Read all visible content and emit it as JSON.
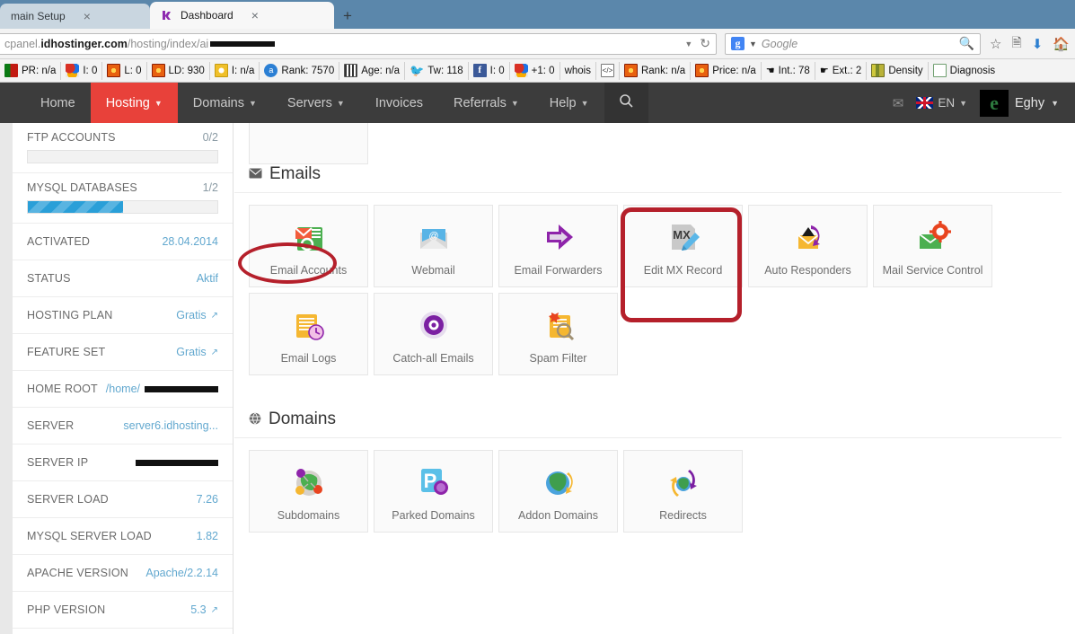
{
  "browser": {
    "tabs": [
      {
        "title": "main Setup",
        "active": false,
        "favicon": "none",
        "close_label": "×"
      },
      {
        "title": "Dashboard",
        "active": true,
        "favicon": "hostinger-icon",
        "close_label": "×"
      }
    ],
    "new_tab_label": "+",
    "url": {
      "prefix": "cpanel.",
      "host": "idhostinger.com",
      "path": "/hosting/index/ai",
      "redacted": true
    },
    "search": {
      "engine": "Google",
      "placeholder": "Google"
    },
    "toolbar_icons": [
      "dropdown-icon",
      "reload-icon",
      "bookmark-star-icon",
      "reader-icon",
      "download-icon",
      "home-icon"
    ],
    "bookmarks": [
      {
        "icon": "pagerank-icon",
        "label": "PR: n/a"
      },
      {
        "icon": "google-icon",
        "label": "I: 0"
      },
      {
        "icon": "sun-icon",
        "label": "L: 0"
      },
      {
        "icon": "sun-icon",
        "label": "LD: 930"
      },
      {
        "icon": "ring-icon",
        "label": "I: n/a"
      },
      {
        "icon": "alexa-icon",
        "label": "Rank: 7570"
      },
      {
        "icon": "barcode-icon",
        "label": "Age: n/a"
      },
      {
        "icon": "twitter-icon",
        "label": "Tw: 118"
      },
      {
        "icon": "facebook-icon",
        "label": "I: 0"
      },
      {
        "icon": "google-plus-icon",
        "label": "+1: 0"
      },
      {
        "icon": "none",
        "label": "whois"
      },
      {
        "icon": "code-icon",
        "label": ""
      },
      {
        "icon": "sun-icon",
        "label": "Rank: n/a"
      },
      {
        "icon": "sun-icon",
        "label": "Price: n/a"
      },
      {
        "icon": "hand-left-icon",
        "label": "Int.: 78"
      },
      {
        "icon": "hand-right-icon",
        "label": "Ext.: 2"
      },
      {
        "icon": "density-icon",
        "label": "Density"
      },
      {
        "icon": "diagnosis-icon",
        "label": "Diagnosis"
      }
    ]
  },
  "topnav": {
    "items": [
      {
        "label": "Home",
        "caret": false,
        "active": false
      },
      {
        "label": "Hosting",
        "caret": true,
        "active": true
      },
      {
        "label": "Domains",
        "caret": true,
        "active": false
      },
      {
        "label": "Servers",
        "caret": true,
        "active": false
      },
      {
        "label": "Invoices",
        "caret": false,
        "active": false
      },
      {
        "label": "Referrals",
        "caret": true,
        "active": false
      },
      {
        "label": "Help",
        "caret": true,
        "active": false
      }
    ],
    "search_icon": "search-icon",
    "mail_icon": "envelope-icon",
    "language": "EN",
    "language_flag": "uk-flag-icon",
    "username": "Eghy",
    "avatar_letter": "e",
    "active_color": "#e8413a",
    "bar_color": "#3c3c3c"
  },
  "sidebar": {
    "usage": [
      {
        "label": "FTP ACCOUNTS",
        "value": "0/2",
        "percent": 0
      },
      {
        "label": "MYSQL DATABASES",
        "value": "1/2",
        "percent": 50
      }
    ],
    "rows": [
      {
        "label": "ACTIVATED",
        "value": "28.04.2014",
        "external": false,
        "redacted": false
      },
      {
        "label": "STATUS",
        "value": "Aktif",
        "external": false,
        "redacted": false
      },
      {
        "label": "HOSTING PLAN",
        "value": "Gratis",
        "external": true,
        "redacted": false
      },
      {
        "label": "FEATURE SET",
        "value": "Gratis",
        "external": true,
        "redacted": false
      },
      {
        "label": "HOME ROOT",
        "value": "/home/",
        "external": false,
        "redacted": true
      },
      {
        "label": "SERVER",
        "value": "server6.idhosting...",
        "external": false,
        "redacted": false
      },
      {
        "label": "SERVER IP",
        "value": "",
        "external": false,
        "redacted": true
      },
      {
        "label": "SERVER LOAD",
        "value": "7.26",
        "external": false,
        "redacted": false
      },
      {
        "label": "MYSQL SERVER LOAD",
        "value": "1.82",
        "external": false,
        "redacted": false
      },
      {
        "label": "APACHE VERSION",
        "value": "Apache/2.2.14",
        "external": false,
        "redacted": false
      },
      {
        "label": "PHP VERSION",
        "value": "5.3",
        "external": true,
        "redacted": false
      }
    ]
  },
  "main": {
    "partial_tile_label": "",
    "sections": [
      {
        "id": "emails",
        "title": "Emails",
        "icon": "envelope-icon",
        "annotated": true,
        "tiles": [
          {
            "label": "Email Accounts",
            "icon": "email-accounts-icon",
            "highlighted": false
          },
          {
            "label": "Webmail",
            "icon": "webmail-icon",
            "highlighted": false
          },
          {
            "label": "Email Forwarders",
            "icon": "email-forwarders-icon",
            "highlighted": false
          },
          {
            "label": "Edit MX Record",
            "icon": "edit-mx-record-icon",
            "highlighted": true
          },
          {
            "label": "Auto Responders",
            "icon": "auto-responders-icon",
            "highlighted": false
          },
          {
            "label": "Mail Service Control",
            "icon": "mail-service-control-icon",
            "highlighted": false
          },
          {
            "label": "Email Logs",
            "icon": "email-logs-icon",
            "highlighted": false
          },
          {
            "label": "Catch-all Emails",
            "icon": "catch-all-emails-icon",
            "highlighted": false
          },
          {
            "label": "Spam Filter",
            "icon": "spam-filter-icon",
            "highlighted": false
          }
        ]
      },
      {
        "id": "domains",
        "title": "Domains",
        "icon": "globe-icon",
        "annotated": false,
        "tiles": [
          {
            "label": "Subdomains",
            "icon": "subdomains-icon",
            "highlighted": false
          },
          {
            "label": "Parked Domains",
            "icon": "parked-domains-icon",
            "highlighted": false
          },
          {
            "label": "Addon Domains",
            "icon": "addon-domains-icon",
            "highlighted": false
          },
          {
            "label": "Redirects",
            "icon": "redirects-icon",
            "highlighted": false
          }
        ]
      }
    ]
  },
  "annotations": {
    "color": "#b5202b",
    "items": [
      {
        "shape": "ellipse",
        "target": "emails-section-heading"
      },
      {
        "shape": "rounded-rect",
        "target": "tile-edit-mx-record"
      }
    ]
  }
}
